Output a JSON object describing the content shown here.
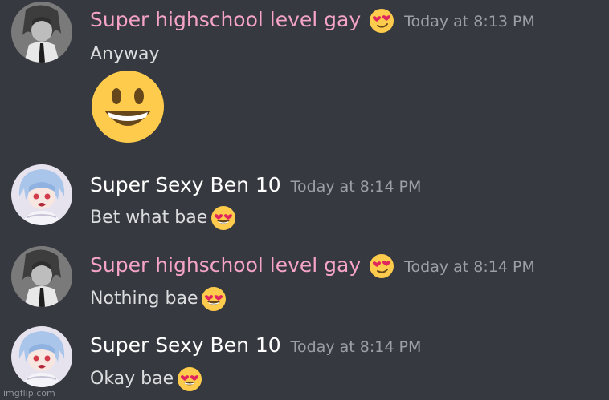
{
  "messages": [
    {
      "author": "Super highschool level gay",
      "author_color": "#f5a3c8",
      "author_emoji": "heart-eyes-wink-emoji",
      "timestamp": "Today at 8:13 PM",
      "content": "Anyway",
      "attached_emoji": "smiley-emoji"
    },
    {
      "author": "Super Sexy Ben 10",
      "author_color": "#ffffff",
      "timestamp": "Today at 8:14 PM",
      "content": "Bet what bae",
      "inline_emoji": "heart-eyes-emoji"
    },
    {
      "author": "Super highschool level gay",
      "author_color": "#f5a3c8",
      "author_emoji": "heart-eyes-wink-emoji",
      "timestamp": "Today at 8:14 PM",
      "content": "Nothing bae",
      "inline_emoji": "heart-eyes-emoji"
    },
    {
      "author": "Super Sexy Ben 10",
      "author_color": "#ffffff",
      "timestamp": "Today at 8:14 PM",
      "content": "Okay bae",
      "inline_emoji": "heart-eyes-emoji"
    }
  ],
  "watermark": "imgflip.com",
  "colors": {
    "background": "#36393f",
    "timestamp": "#9ca0a6",
    "message_text": "#dcddde"
  }
}
